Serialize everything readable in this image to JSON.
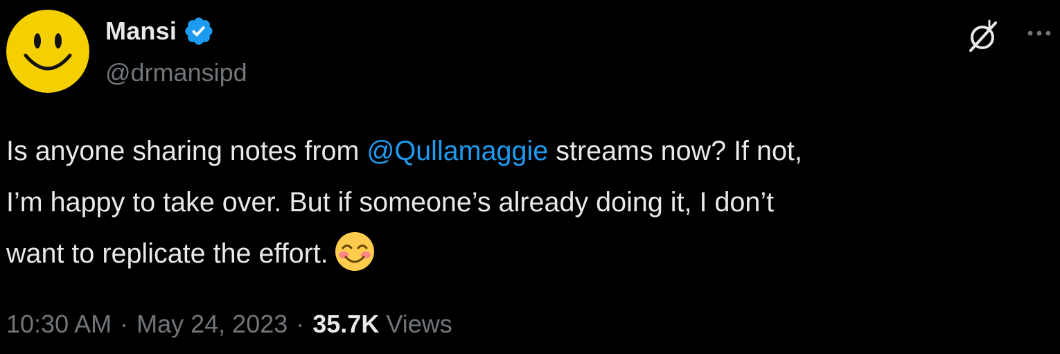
{
  "author": {
    "display_name": "Mansi",
    "handle": "@drmansipd",
    "verified": true,
    "avatar": "smiley-face-avatar"
  },
  "actions": {
    "grok_icon": "grok-icon",
    "more_icon": "more-options-icon"
  },
  "tweet": {
    "line1_before": "Is anyone sharing notes from ",
    "mention": "@Qullamaggie",
    "line1_after": " streams now? If not,",
    "line2": "I’m happy to take over. But if someone’s already doing it, I don’t",
    "line3": "want to replicate the effort.",
    "emoji": "smiling-face-with-smiling-eyes"
  },
  "meta": {
    "time": "10:30 AM",
    "separator": "·",
    "date": "May 24, 2023",
    "separator2": "·",
    "views_count": "35.7K",
    "views_label": "Views"
  },
  "colors": {
    "background": "#000000",
    "text": "#e7e9ea",
    "secondary": "#71767b",
    "accent": "#1d9bf0",
    "avatar_yellow": "#f5d000"
  }
}
